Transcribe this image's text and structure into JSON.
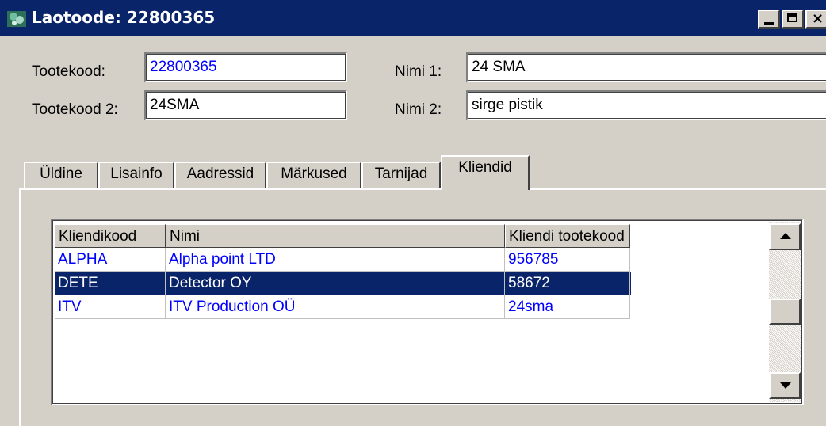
{
  "window": {
    "title": "Laotoode: 22800365"
  },
  "form": {
    "tootekood_label": "Tootekood:",
    "tootekood_value": "22800365",
    "tootekood2_label": "Tootekood 2:",
    "tootekood2_value": "24SMA",
    "nimi1_label": "Nimi 1:",
    "nimi1_value": "24 SMA",
    "nimi2_label": "Nimi 2:",
    "nimi2_value": "sirge pistik"
  },
  "tabs": [
    {
      "label": "Üldine"
    },
    {
      "label": "Lisainfo"
    },
    {
      "label": "Aadressid"
    },
    {
      "label": "Märkused"
    },
    {
      "label": "Tarnijad"
    },
    {
      "label": "Kliendid"
    }
  ],
  "active_tab": "Kliendid",
  "table": {
    "columns": [
      "Kliendikood",
      "Nimi",
      "Kliendi tootekood"
    ],
    "rows": [
      {
        "kood": "ALPHA",
        "nimi": "Alpha point LTD",
        "tootekood": "956785"
      },
      {
        "kood": "DETE",
        "nimi": "Detector OY",
        "tootekood": "58672"
      },
      {
        "kood": "ITV",
        "nimi": "ITV Production OÜ",
        "tootekood": "24sma"
      }
    ],
    "selected_row": "DETE"
  },
  "colors": {
    "titlebar": "#0a246a",
    "face": "#d4d0c8",
    "link_text": "#0000ff",
    "selection": "#0a246a"
  },
  "icons": {
    "app": "app-icon",
    "minimize": "minimize-icon",
    "maximize": "maximize-icon",
    "close": "close-icon",
    "scroll_up": "arrow-up-icon",
    "scroll_down": "arrow-down-icon"
  }
}
